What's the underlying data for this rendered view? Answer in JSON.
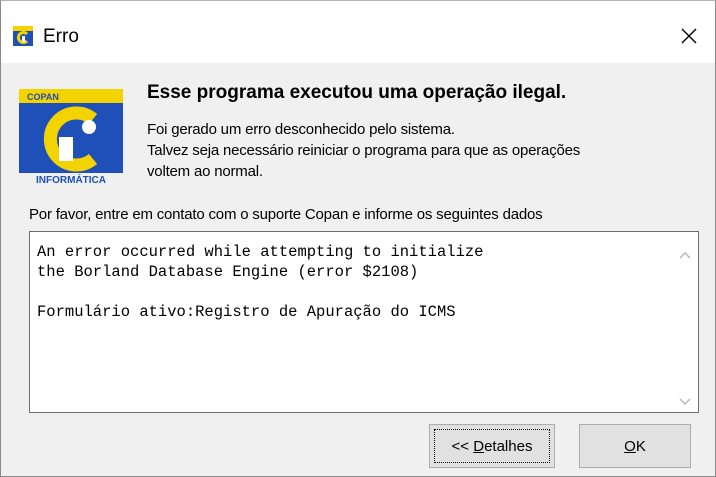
{
  "window": {
    "title": "Erro"
  },
  "dialog": {
    "heading": "Esse programa executou uma operação ilegal.",
    "description_lines": [
      "Foi gerado um erro desconhecido pelo sistema.",
      "Talvez seja necessário reiniciar o programa para que as operações",
      "voltem ao normal."
    ],
    "contact_text": "Por favor, entre em contato com o suporte Copan e informe os seguintes dados",
    "details_text": "An error occurred while attempting to initialize\nthe Borland Database Engine (error $2108)\n\nFormulário ativo:Registro de Apuração do ICMS"
  },
  "logo": {
    "top_text": "COPAN",
    "bottom_text": "INFORMÁTICA",
    "icon": "copan-logo"
  },
  "buttons": {
    "details_prefix": "<< ",
    "details_mnemonic": "D",
    "details_rest": "etalhes",
    "ok_mnemonic": "O",
    "ok_rest": "K"
  },
  "icons": {
    "title": "app-icon",
    "close": "close-icon",
    "scroll_up": "chevron-up-icon",
    "scroll_down": "chevron-down-icon"
  },
  "colors": {
    "dialog_bg": "#f0f0f0",
    "logo_blue": "#1f4fb8",
    "logo_yellow": "#f3d300"
  }
}
